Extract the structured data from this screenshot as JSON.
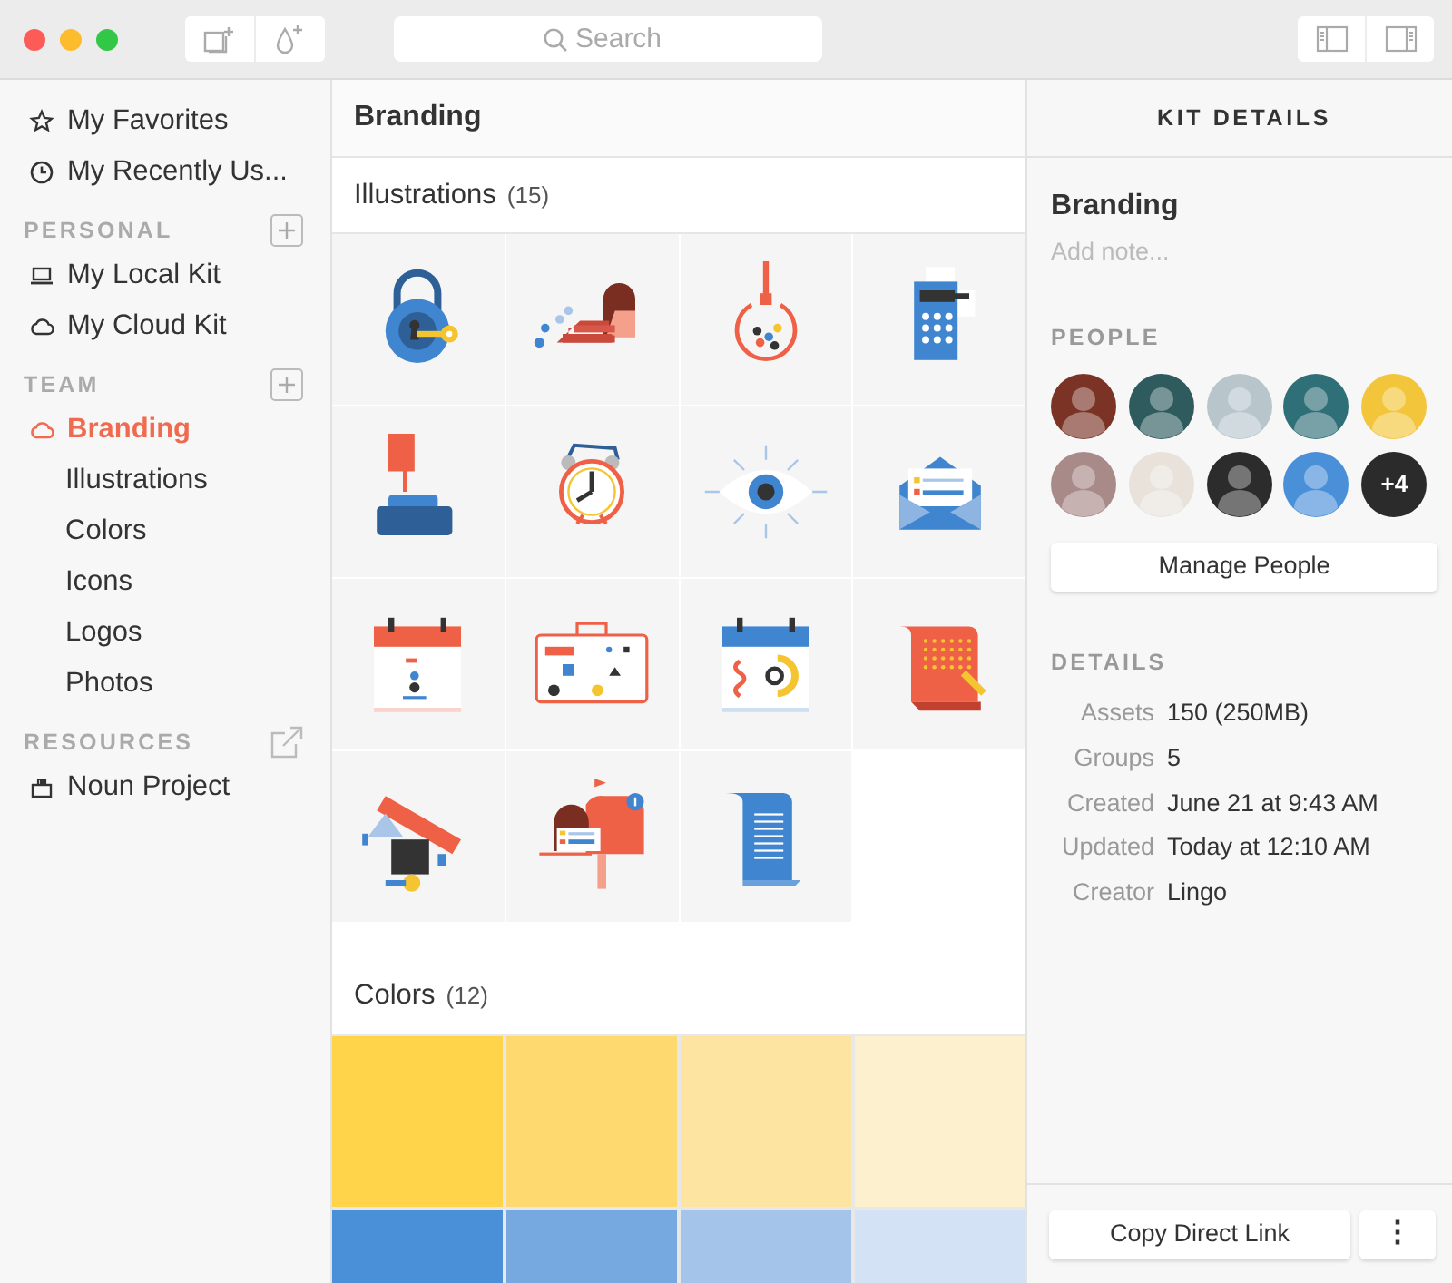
{
  "toolbar": {
    "search": {
      "placeholder": "Search"
    }
  },
  "sidebar": {
    "top": [
      {
        "label": "My Favorites",
        "selected": false
      },
      {
        "label": "My Recently Us...",
        "selected": false
      }
    ],
    "sections": [
      {
        "title": "PERSONAL",
        "kind": "add",
        "items": [
          {
            "label": "My Local Kit",
            "selected": false
          },
          {
            "label": "My Cloud Kit",
            "selected": false
          }
        ]
      },
      {
        "title": "TEAM",
        "kind": "add",
        "items": [
          {
            "label": "Branding",
            "selected": true,
            "children": [
              {
                "label": "Illustrations",
                "selected": false
              },
              {
                "label": "Colors",
                "selected": false
              },
              {
                "label": "Icons",
                "selected": false
              },
              {
                "label": "Logos",
                "selected": false
              },
              {
                "label": "Photos",
                "selected": false
              }
            ]
          }
        ]
      },
      {
        "title": "RESOURCES",
        "kind": "external",
        "items": [
          {
            "label": "Noun Project",
            "selected": false
          }
        ]
      }
    ]
  },
  "main": {
    "title": "Branding",
    "illustrations": {
      "title": "Illustrations",
      "count": "(15)"
    },
    "colors": {
      "title": "Colors",
      "count": "(12)",
      "swatches": [
        {
          "color": "#ffd44a"
        },
        {
          "color": "#fdd970"
        },
        {
          "color": "#fde4a0"
        },
        {
          "color": "#fdf0cf"
        },
        {
          "color": "#4a90d9"
        },
        {
          "color": "#76a9df"
        },
        {
          "color": "#a5c4ea"
        },
        {
          "color": "#d3e2f4"
        }
      ]
    }
  },
  "details_panel": {
    "title": "KIT DETAILS",
    "kit_name": "Branding",
    "note": {
      "placeholder": "Add note..."
    },
    "people": {
      "title": "PEOPLE",
      "avatars": [
        {
          "color": "#7a3325"
        },
        {
          "color": "#2f5b5e"
        },
        {
          "color": "#b8c6cc"
        },
        {
          "color": "#2f6f78"
        },
        {
          "color": "#f3c53a"
        },
        {
          "color": "#a88a88"
        },
        {
          "color": "#e8e2da"
        },
        {
          "color": "#2c2c2c"
        },
        {
          "color": "#4a90d9"
        }
      ],
      "more": "+4",
      "button": "Manage People"
    },
    "details": {
      "title": "DETAILS",
      "rows": [
        {
          "label": "Assets",
          "value": "150 (250MB)"
        },
        {
          "label": "Groups",
          "value": "5"
        },
        {
          "label": "Created",
          "value": "June 21 at 9:43 AM"
        },
        {
          "label": "Updated",
          "value": "Today at 12:10 AM"
        },
        {
          "label": "Creator",
          "value": "Lingo"
        }
      ]
    },
    "footer": {
      "button": "Copy Direct Link",
      "more": "⋮"
    }
  }
}
